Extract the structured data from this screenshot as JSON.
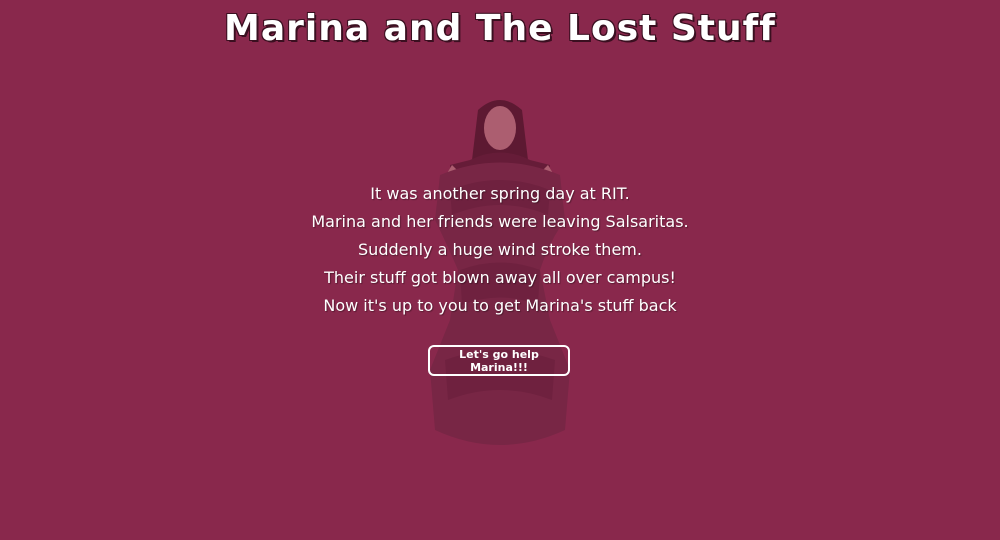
{
  "page": {
    "title": "Marina and The Lost Stuff",
    "background_color": "#89284c"
  },
  "hero": {
    "image": "marina-photo"
  },
  "story": {
    "lines": [
      "It was another spring day at RIT.",
      "Marina and her friends were leaving Salsaritas.",
      "Suddenly a huge wind stroke them.",
      "Their stuff got blown away all over campus!",
      "Now it's up to you to get Marina's stuff back"
    ]
  },
  "cta": {
    "label": "Let's go help Marina!!!"
  }
}
